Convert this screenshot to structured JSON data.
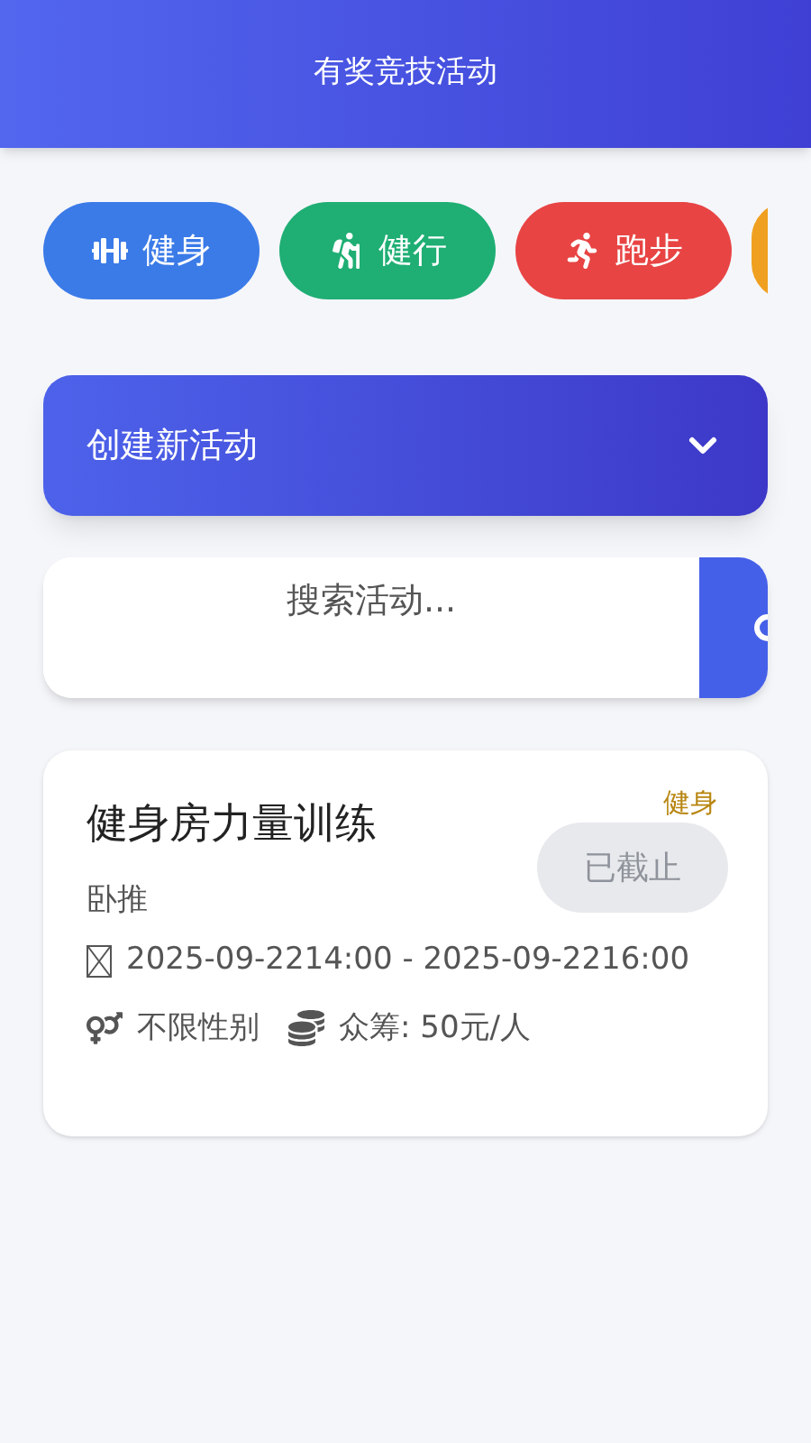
{
  "header": {
    "title": "有奖竞技活动"
  },
  "categories": [
    {
      "kind": "fitness",
      "label": "健身",
      "color": "#3b7be8"
    },
    {
      "kind": "hiking",
      "label": "健行",
      "color": "#1fae74"
    },
    {
      "kind": "running",
      "label": "跑步",
      "color": "#e84444"
    },
    {
      "kind": "partial",
      "color": "#f0a020"
    }
  ],
  "create": {
    "label": "创建新活动",
    "expanded": false
  },
  "search": {
    "placeholder": "搜索活动..."
  },
  "activities": [
    {
      "title": "健身房力量训练",
      "tag": "健身",
      "status": "已截止",
      "disabled": true,
      "subtitle": "卧推",
      "time": "2025-09-2214:00 - 2025-09-2216:00",
      "gender": "不限性别",
      "fee": "众筹: 50元/人"
    }
  ]
}
